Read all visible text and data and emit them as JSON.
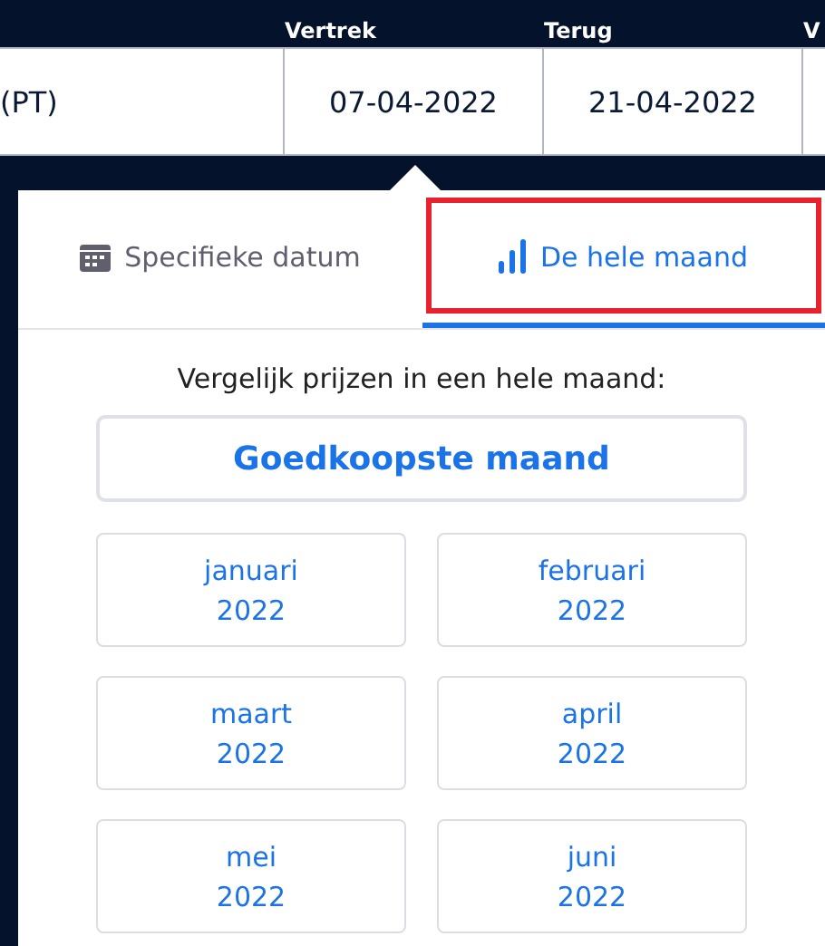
{
  "search_bar": {
    "columns": [
      {
        "value": "(PT)"
      },
      {
        "label": "Vertrek",
        "value": "07-04-2022"
      },
      {
        "label": "Terug",
        "value": "21-04-2022"
      },
      {
        "label": "V"
      }
    ]
  },
  "tabs": [
    {
      "label": "Specifieke datum",
      "kind": "calendar",
      "selected": false,
      "highlighted": false
    },
    {
      "label": "De hele maand",
      "kind": "chart",
      "selected": true,
      "highlighted": true
    }
  ],
  "prompt": "Vergelijk prijzen in een hele maand:",
  "cheapest_button": "Goedkoopste maand",
  "months": [
    {
      "month": "januari",
      "year": "2022"
    },
    {
      "month": "februari",
      "year": "2022"
    },
    {
      "month": "maart",
      "year": "2022"
    },
    {
      "month": "april",
      "year": "2022"
    },
    {
      "month": "mei",
      "year": "2022"
    },
    {
      "month": "juni",
      "year": "2022"
    }
  ]
}
